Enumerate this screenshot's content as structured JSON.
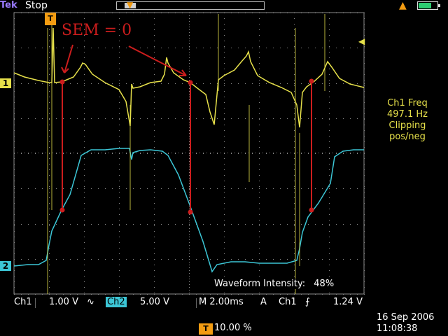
{
  "header": {
    "brand": "Tek",
    "run_state": "Stop",
    "icons": [
      "trigger-position-icon",
      "warning-icon",
      "battery-icon"
    ]
  },
  "markers": {
    "ch1": "1",
    "ch2": "2",
    "trigger_time": "T"
  },
  "annotation": {
    "label": "SEM = 0",
    "color": "#cc1d1d"
  },
  "sidebar": {
    "lines": [
      "Ch1 Freq",
      "497.1 Hz",
      "Clipping",
      "pos/neg"
    ]
  },
  "intensity": {
    "label": "Waveform Intensity:",
    "value": "48%"
  },
  "status": {
    "ch1_label": "Ch1",
    "ch1_scale": "1.00 V",
    "ch1_coupling": "∿",
    "ch2_label": "Ch2",
    "ch2_scale": "5.00 V",
    "timebase": "M 2.00ms",
    "trigger_mode": "A",
    "trigger_source": "Ch1",
    "trigger_slope": "⨍",
    "trigger_level": "1.24 V"
  },
  "footer": {
    "pretrigger": "10.00 %",
    "date": "16 Sep  2006",
    "time": "11:08:38"
  },
  "colors": {
    "ch1": "#e6e04a",
    "ch2": "#3cc6d6",
    "trigger": "#f39c12",
    "grid": "#8a8a8a"
  }
}
